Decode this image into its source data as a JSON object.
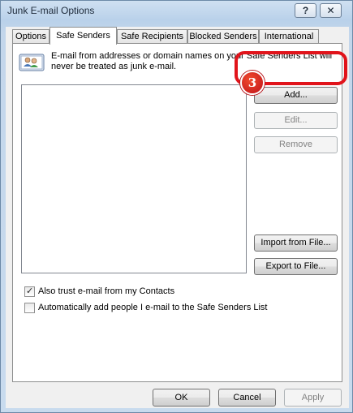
{
  "window": {
    "title": "Junk E-mail Options",
    "help_label": "?",
    "close_label": "✕"
  },
  "tabs": [
    {
      "label": "Options"
    },
    {
      "label": "Safe Senders"
    },
    {
      "label": "Safe Recipients"
    },
    {
      "label": "Blocked Senders"
    },
    {
      "label": "International"
    }
  ],
  "active_tab": "Safe Senders",
  "panel": {
    "info_icon": "people-card-icon",
    "info_text": "E-mail from addresses or domain names on your Safe Senders List will never be treated as junk e-mail.",
    "list_items": [],
    "buttons": {
      "add": "Add...",
      "edit": "Edit...",
      "remove": "Remove",
      "import": "Import from File...",
      "export": "Export to File..."
    },
    "checkboxes": [
      {
        "label": "Also trust e-mail from my Contacts",
        "checked": true
      },
      {
        "label": "Automatically add people I e-mail to the Safe Senders List",
        "checked": false
      }
    ]
  },
  "annotation": {
    "step_number": "3",
    "color": "#e1141b"
  },
  "footer": {
    "ok": "OK",
    "cancel": "Cancel",
    "apply": "Apply"
  }
}
